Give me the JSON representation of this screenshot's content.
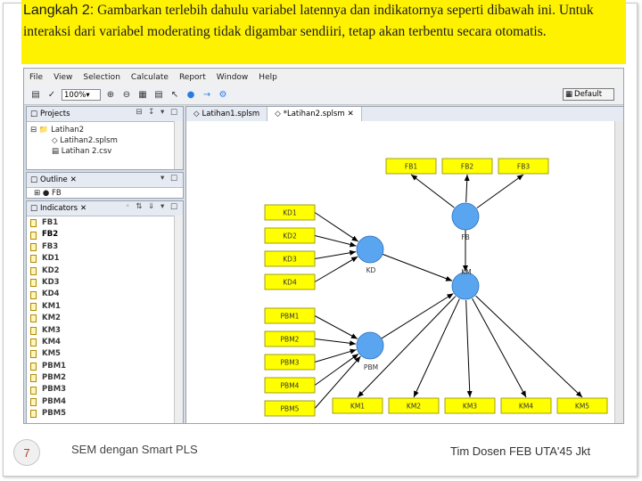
{
  "callout": {
    "step": "Langkah 2:",
    "text": " Gambarkan terlebih dahulu variabel latennya dan indikatornya seperti dibawah ini. Untuk interaksi dari variabel moderating tidak digambar sendiiri, tetap akan terbentu secara otomatis."
  },
  "app": {
    "menu": [
      "File",
      "View",
      "Selection",
      "Calculate",
      "Report",
      "Window",
      "Help"
    ],
    "toolbar": {
      "zoom": "100%",
      "perspective": "Default",
      "icons": [
        "save-icon",
        "select-icon",
        "zoom-in-icon",
        "zoom-out-icon",
        "pointer-icon",
        "latent-variable-icon",
        "connect-icon"
      ]
    },
    "projects_panel": {
      "title": "Projects",
      "tree": [
        "Latihan2",
        "Latihan2.splsm",
        "Latihan 2.csv"
      ]
    },
    "outline_panel": {
      "title": "Outline",
      "tree": [
        "FB"
      ]
    },
    "indicators_panel": {
      "title": "Indicators",
      "items": [
        "FB1",
        "FB2",
        "FB3",
        "KD1",
        "KD2",
        "KD3",
        "KD4",
        "KM1",
        "KM2",
        "KM3",
        "KM4",
        "KM5",
        "PBM1",
        "PBM2",
        "PBM3",
        "PBM4",
        "PBM5"
      ],
      "selected": "FB2"
    },
    "editor_tabs": [
      "Latihan1.splsm",
      "*Latihan2.splsm"
    ],
    "model": {
      "latent_variables": [
        "FB",
        "KD",
        "KM",
        "PBM"
      ],
      "indicators": {
        "FB": [
          "FB1",
          "FB2",
          "FB3"
        ],
        "KD": [
          "KD1",
          "KD2",
          "KD3",
          "KD4"
        ],
        "PBM": [
          "PBM1",
          "PBM2",
          "PBM3",
          "PBM4",
          "PBM5"
        ],
        "KM": [
          "KM1",
          "KM2",
          "KM3",
          "KM4",
          "KM5"
        ]
      },
      "colors": {
        "latent": "#5aa5f0",
        "indicator": "#ffff00",
        "arrow": "#000000"
      }
    }
  },
  "footer": {
    "slide_number": "7",
    "left": "SEM dengan Smart PLS",
    "right": "Tim Dosen FEB UTA'45 Jkt"
  }
}
